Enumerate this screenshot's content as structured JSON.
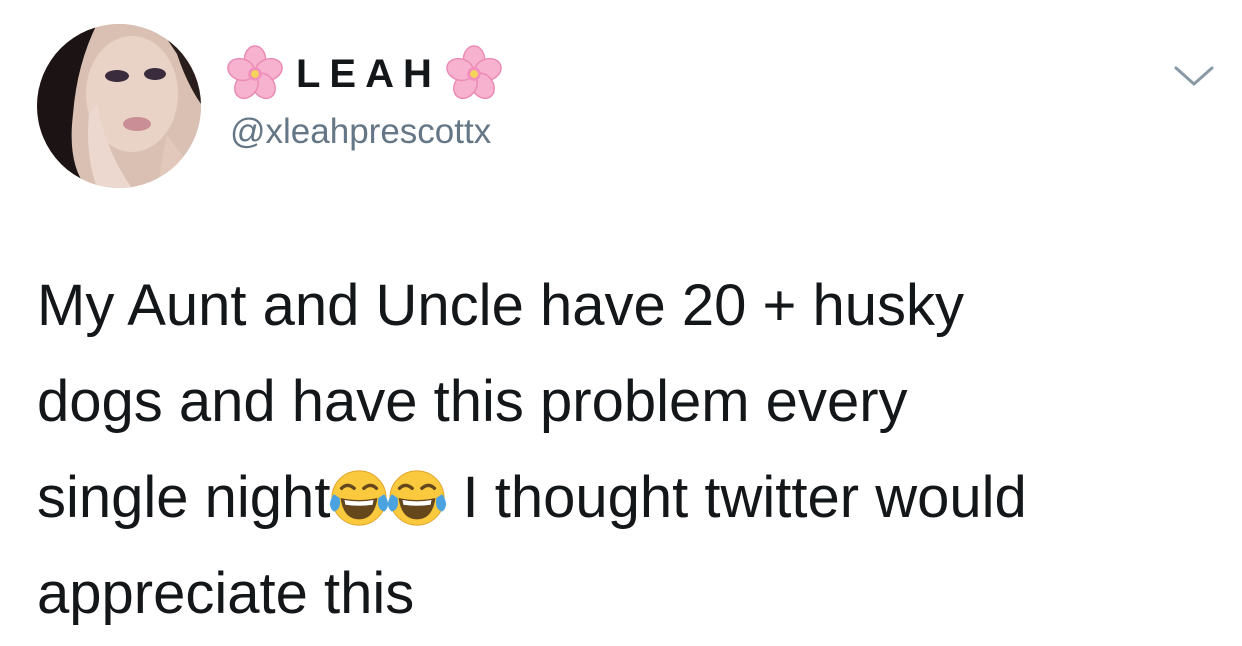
{
  "tweet": {
    "display_name": "LEAH",
    "handle": "@xleahprescottx",
    "name_emoji_icon": "cherry-blossom-icon",
    "menu_icon": "chevron-down-icon",
    "text": {
      "line1": "My Aunt and Uncle have 20 + husky",
      "line2": "dogs and have this problem every",
      "line3_start": "single night",
      "line3_emoji_icon": "face-with-tears-of-joy-icon",
      "line3_end": " I thought twitter would",
      "line4": "appreciate this"
    }
  },
  "colors": {
    "text": "#14171a",
    "secondary_text": "#657786",
    "background": "#ffffff",
    "blossom_pink": "#f5a3c7",
    "emoji_yellow": "#fbc93d",
    "tear_blue": "#4aa3df"
  }
}
